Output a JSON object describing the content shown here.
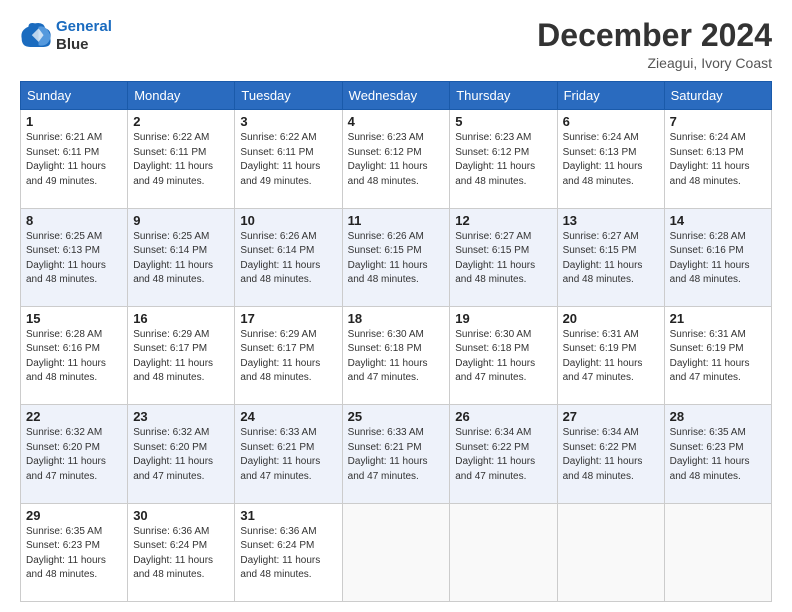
{
  "header": {
    "logo_line1": "General",
    "logo_line2": "Blue",
    "month_title": "December 2024",
    "location": "Zieagui, Ivory Coast"
  },
  "weekdays": [
    "Sunday",
    "Monday",
    "Tuesday",
    "Wednesday",
    "Thursday",
    "Friday",
    "Saturday"
  ],
  "weeks": [
    [
      {
        "day": "1",
        "rise": "6:21 AM",
        "set": "6:11 PM",
        "daylight": "11 hours and 49 minutes."
      },
      {
        "day": "2",
        "rise": "6:22 AM",
        "set": "6:11 PM",
        "daylight": "11 hours and 49 minutes."
      },
      {
        "day": "3",
        "rise": "6:22 AM",
        "set": "6:11 PM",
        "daylight": "11 hours and 49 minutes."
      },
      {
        "day": "4",
        "rise": "6:23 AM",
        "set": "6:12 PM",
        "daylight": "11 hours and 48 minutes."
      },
      {
        "day": "5",
        "rise": "6:23 AM",
        "set": "6:12 PM",
        "daylight": "11 hours and 48 minutes."
      },
      {
        "day": "6",
        "rise": "6:24 AM",
        "set": "6:13 PM",
        "daylight": "11 hours and 48 minutes."
      },
      {
        "day": "7",
        "rise": "6:24 AM",
        "set": "6:13 PM",
        "daylight": "11 hours and 48 minutes."
      }
    ],
    [
      {
        "day": "8",
        "rise": "6:25 AM",
        "set": "6:13 PM",
        "daylight": "11 hours and 48 minutes."
      },
      {
        "day": "9",
        "rise": "6:25 AM",
        "set": "6:14 PM",
        "daylight": "11 hours and 48 minutes."
      },
      {
        "day": "10",
        "rise": "6:26 AM",
        "set": "6:14 PM",
        "daylight": "11 hours and 48 minutes."
      },
      {
        "day": "11",
        "rise": "6:26 AM",
        "set": "6:15 PM",
        "daylight": "11 hours and 48 minutes."
      },
      {
        "day": "12",
        "rise": "6:27 AM",
        "set": "6:15 PM",
        "daylight": "11 hours and 48 minutes."
      },
      {
        "day": "13",
        "rise": "6:27 AM",
        "set": "6:15 PM",
        "daylight": "11 hours and 48 minutes."
      },
      {
        "day": "14",
        "rise": "6:28 AM",
        "set": "6:16 PM",
        "daylight": "11 hours and 48 minutes."
      }
    ],
    [
      {
        "day": "15",
        "rise": "6:28 AM",
        "set": "6:16 PM",
        "daylight": "11 hours and 48 minutes."
      },
      {
        "day": "16",
        "rise": "6:29 AM",
        "set": "6:17 PM",
        "daylight": "11 hours and 48 minutes."
      },
      {
        "day": "17",
        "rise": "6:29 AM",
        "set": "6:17 PM",
        "daylight": "11 hours and 48 minutes."
      },
      {
        "day": "18",
        "rise": "6:30 AM",
        "set": "6:18 PM",
        "daylight": "11 hours and 47 minutes."
      },
      {
        "day": "19",
        "rise": "6:30 AM",
        "set": "6:18 PM",
        "daylight": "11 hours and 47 minutes."
      },
      {
        "day": "20",
        "rise": "6:31 AM",
        "set": "6:19 PM",
        "daylight": "11 hours and 47 minutes."
      },
      {
        "day": "21",
        "rise": "6:31 AM",
        "set": "6:19 PM",
        "daylight": "11 hours and 47 minutes."
      }
    ],
    [
      {
        "day": "22",
        "rise": "6:32 AM",
        "set": "6:20 PM",
        "daylight": "11 hours and 47 minutes."
      },
      {
        "day": "23",
        "rise": "6:32 AM",
        "set": "6:20 PM",
        "daylight": "11 hours and 47 minutes."
      },
      {
        "day": "24",
        "rise": "6:33 AM",
        "set": "6:21 PM",
        "daylight": "11 hours and 47 minutes."
      },
      {
        "day": "25",
        "rise": "6:33 AM",
        "set": "6:21 PM",
        "daylight": "11 hours and 47 minutes."
      },
      {
        "day": "26",
        "rise": "6:34 AM",
        "set": "6:22 PM",
        "daylight": "11 hours and 47 minutes."
      },
      {
        "day": "27",
        "rise": "6:34 AM",
        "set": "6:22 PM",
        "daylight": "11 hours and 48 minutes."
      },
      {
        "day": "28",
        "rise": "6:35 AM",
        "set": "6:23 PM",
        "daylight": "11 hours and 48 minutes."
      }
    ],
    [
      {
        "day": "29",
        "rise": "6:35 AM",
        "set": "6:23 PM",
        "daylight": "11 hours and 48 minutes."
      },
      {
        "day": "30",
        "rise": "6:36 AM",
        "set": "6:24 PM",
        "daylight": "11 hours and 48 minutes."
      },
      {
        "day": "31",
        "rise": "6:36 AM",
        "set": "6:24 PM",
        "daylight": "11 hours and 48 minutes."
      },
      null,
      null,
      null,
      null
    ]
  ]
}
